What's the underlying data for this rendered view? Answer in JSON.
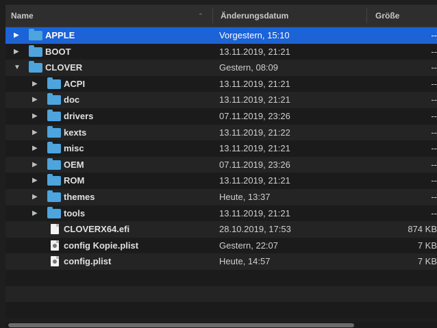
{
  "columns": {
    "name": "Name",
    "date": "Änderungsdatum",
    "size": "Größe"
  },
  "rows": [
    {
      "name": "APPLE",
      "date": "Vorgestern, 15:10",
      "size": "--",
      "kind": "folder",
      "depth": 0,
      "expanded": false,
      "selected": true
    },
    {
      "name": "BOOT",
      "date": "13.11.2019, 21:21",
      "size": "--",
      "kind": "folder",
      "depth": 0,
      "expanded": false,
      "selected": false
    },
    {
      "name": "CLOVER",
      "date": "Gestern, 08:09",
      "size": "--",
      "kind": "folder",
      "depth": 0,
      "expanded": true,
      "selected": false
    },
    {
      "name": "ACPI",
      "date": "13.11.2019, 21:21",
      "size": "--",
      "kind": "folder",
      "depth": 1,
      "expanded": false,
      "selected": false
    },
    {
      "name": "doc",
      "date": "13.11.2019, 21:21",
      "size": "--",
      "kind": "folder",
      "depth": 1,
      "expanded": false,
      "selected": false
    },
    {
      "name": "drivers",
      "date": "07.11.2019, 23:26",
      "size": "--",
      "kind": "folder",
      "depth": 1,
      "expanded": false,
      "selected": false
    },
    {
      "name": "kexts",
      "date": "13.11.2019, 21:22",
      "size": "--",
      "kind": "folder",
      "depth": 1,
      "expanded": false,
      "selected": false
    },
    {
      "name": "misc",
      "date": "13.11.2019, 21:21",
      "size": "--",
      "kind": "folder",
      "depth": 1,
      "expanded": false,
      "selected": false
    },
    {
      "name": "OEM",
      "date": "07.11.2019, 23:26",
      "size": "--",
      "kind": "folder",
      "depth": 1,
      "expanded": false,
      "selected": false
    },
    {
      "name": "ROM",
      "date": "13.11.2019, 21:21",
      "size": "--",
      "kind": "folder",
      "depth": 1,
      "expanded": false,
      "selected": false
    },
    {
      "name": "themes",
      "date": "Heute, 13:37",
      "size": "--",
      "kind": "folder",
      "depth": 1,
      "expanded": false,
      "selected": false
    },
    {
      "name": "tools",
      "date": "13.11.2019, 21:21",
      "size": "--",
      "kind": "folder",
      "depth": 1,
      "expanded": false,
      "selected": false
    },
    {
      "name": "CLOVERX64.efi",
      "date": "28.10.2019, 17:53",
      "size": "874 KB",
      "kind": "file",
      "depth": 1,
      "expanded": false,
      "selected": false
    },
    {
      "name": "config Kopie.plist",
      "date": "Gestern, 22:07",
      "size": "7 KB",
      "kind": "plist",
      "depth": 1,
      "expanded": false,
      "selected": false
    },
    {
      "name": "config.plist",
      "date": "Heute, 14:57",
      "size": "7 KB",
      "kind": "plist",
      "depth": 1,
      "expanded": false,
      "selected": false
    }
  ],
  "icons": {
    "folder": "folder-icon",
    "file": "document-icon",
    "plist": "plist-document-icon",
    "collapsed": "disclosure-triangle-right-icon",
    "expanded": "disclosure-triangle-down-icon",
    "sort": "chevron-up-icon"
  },
  "colors": {
    "selection": "#1b63d6",
    "folder": "#4ea4dc",
    "background": "#1e1e1e"
  }
}
